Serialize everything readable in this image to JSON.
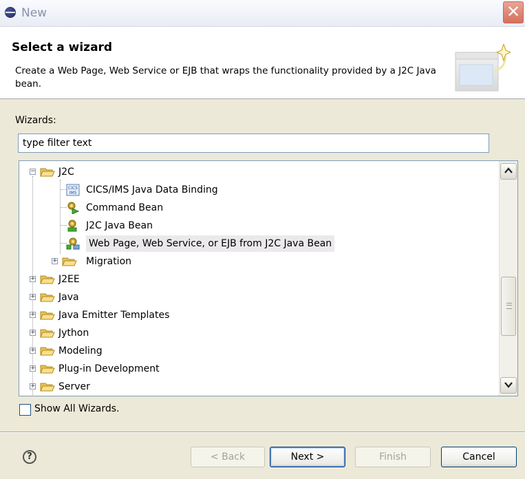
{
  "window": {
    "title": "New",
    "close_symbol": "✕"
  },
  "header": {
    "title": "Select a wizard",
    "description": "Create a Web Page, Web Service or EJB that wraps the functionality provided by a J2C Java bean."
  },
  "wizards_label": "Wizards:",
  "filter": {
    "value": "type filter text"
  },
  "tree": {
    "items": [
      {
        "label": "J2C",
        "expanded": true
      },
      {
        "label": "CICS/IMS Java Data Binding",
        "icon": "cics-ims-icon"
      },
      {
        "label": "Command Bean",
        "icon": "command-bean-icon"
      },
      {
        "label": "J2C Java Bean",
        "icon": "java-bean-icon"
      },
      {
        "label": "Web Page, Web Service, or EJB from J2C Java Bean",
        "icon": "web-bean-icon",
        "selected": true
      },
      {
        "label": "Migration",
        "expanded": false
      },
      {
        "label": "J2EE",
        "expanded": false
      },
      {
        "label": "Java",
        "expanded": false
      },
      {
        "label": "Java Emitter Templates",
        "expanded": false
      },
      {
        "label": "Jython",
        "expanded": false
      },
      {
        "label": "Modeling",
        "expanded": false
      },
      {
        "label": "Plug-in Development",
        "expanded": false
      },
      {
        "label": "Server",
        "expanded": false
      }
    ]
  },
  "show_all": {
    "label": "Show All Wizards.",
    "checked": false
  },
  "buttons": {
    "help": "?",
    "back": "< Back",
    "next": "Next >",
    "finish": "Finish",
    "cancel": "Cancel"
  },
  "cics_badge": "CICS IMS"
}
